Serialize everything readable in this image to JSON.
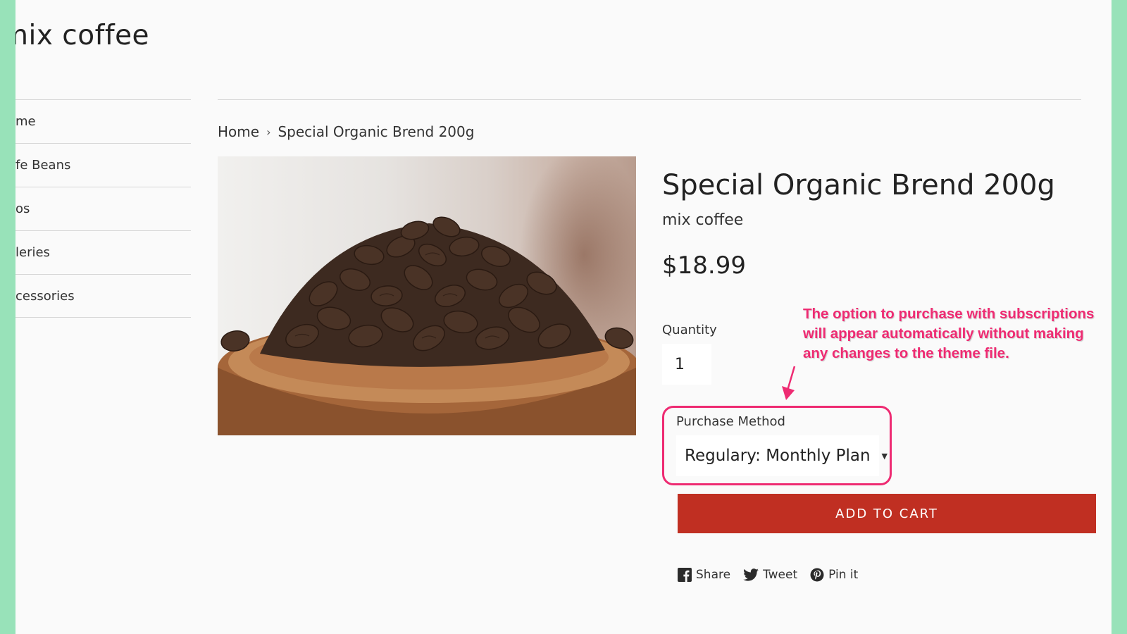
{
  "store": {
    "name": "mix coffee"
  },
  "sidebar": {
    "items": [
      {
        "label": "me"
      },
      {
        "label": "fe Beans"
      },
      {
        "label": "os"
      },
      {
        "label": "leries"
      },
      {
        "label": "cessories"
      }
    ]
  },
  "breadcrumb": {
    "home": "Home",
    "separator": "›",
    "current": "Special Organic Brend 200g"
  },
  "product": {
    "title": "Special Organic Brend 200g",
    "vendor": "mix coffee",
    "price": "$18.99",
    "quantity_label": "Quantity",
    "quantity_value": "1",
    "purchase_method_label": "Purchase Method",
    "purchase_method_value": "Regulary: Monthly Plan",
    "add_to_cart": "ADD TO CART"
  },
  "social": {
    "share": "Share",
    "tweet": "Tweet",
    "pin": "Pin it"
  },
  "annotation": {
    "line1": "The option to purchase with subscriptions",
    "line2": "will appear automatically without making",
    "line3": "any changes to the theme file."
  },
  "colors": {
    "frame": "#98e2b9",
    "page_bg": "#fafafa",
    "add_to_cart_bg": "#c02f22",
    "annotation": "#ee2b72"
  },
  "icons": [
    "facebook-icon",
    "twitter-icon",
    "pinterest-icon",
    "chevron-down-icon"
  ]
}
